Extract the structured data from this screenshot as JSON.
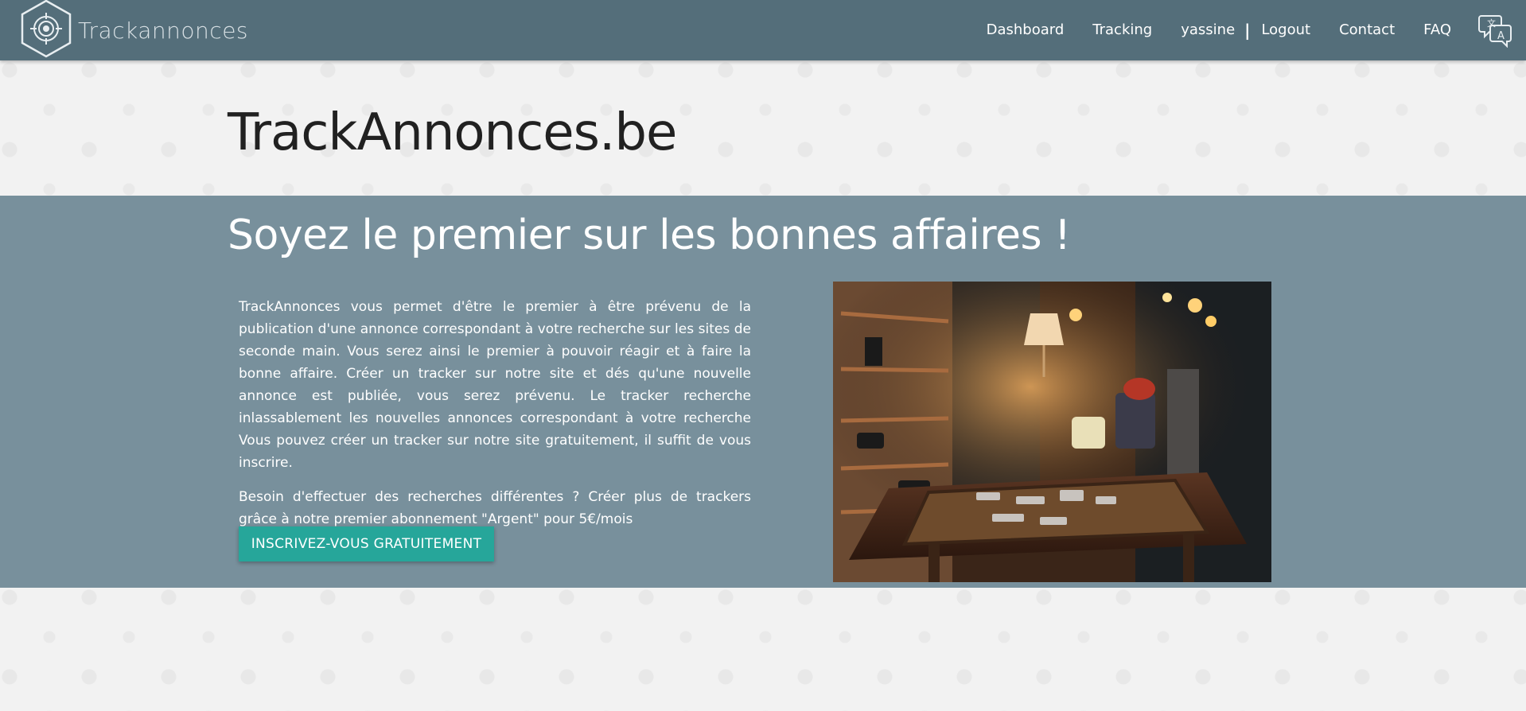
{
  "navbar": {
    "brand": "Trackannonces",
    "links": {
      "dashboard": "Dashboard",
      "tracking": "Tracking",
      "user": "yassine",
      "separator": "|",
      "logout": "Logout",
      "contact": "Contact",
      "faq": "FAQ"
    },
    "icons": {
      "logo": "target-hexagon-icon",
      "language": "translate-icon"
    }
  },
  "hero": {
    "site_title": "TrackAnnonces.be",
    "headline": "Soyez le premier sur les bonnes affaires !",
    "paragraph_1": "TrackAnnonces vous permet d'être le premier à être prévenu de la publication d'une annonce correspondant à votre recherche sur les sites de seconde main. Vous serez ainsi le premier à pouvoir réagir et à faire la bonne affaire. Créer un tracker sur notre site et dés qu'une nouvelle annonce est publiée, vous serez prévenu. Le tracker recherche inlassablement les nouvelles annonces correspondant à votre recherche Vous pouvez créer un tracker sur notre site gratuitement, il suffit de vous inscrire.",
    "paragraph_2": "Besoin d'effectuer des recherches différentes ? Créer plus de trackers grâce à notre premier abonnement \"Argent\" pour 5€/mois",
    "cta_label": "INSCRIVEZ-VOUS GRATUITEMENT"
  },
  "colors": {
    "navbar": "#546e7a",
    "band": "#78909c",
    "cta": "#26a69a",
    "background": "#f2f2f2"
  }
}
